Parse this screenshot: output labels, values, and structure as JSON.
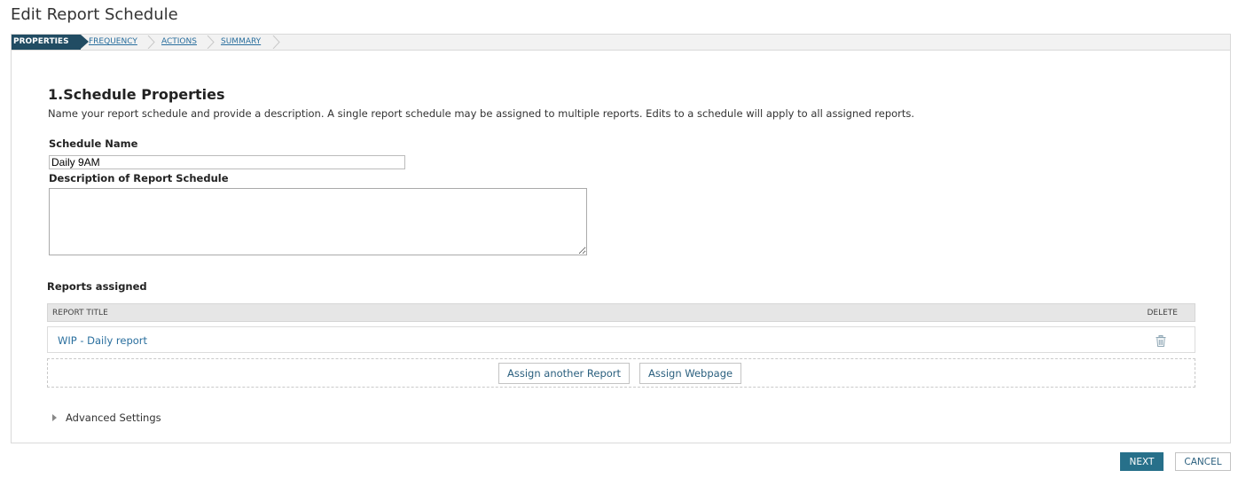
{
  "page": {
    "title": "Edit Report Schedule"
  },
  "steps": [
    {
      "label": "PROPERTIES",
      "active": true
    },
    {
      "label": "FREQUENCY",
      "active": false
    },
    {
      "label": "ACTIONS",
      "active": false
    },
    {
      "label": "SUMMARY",
      "active": false
    }
  ],
  "section": {
    "title": "1.Schedule Properties",
    "description": "Name your report schedule and provide a description. A single report schedule may be assigned to multiple reports. Edits to a schedule will apply to all assigned reports."
  },
  "form": {
    "name_label": "Schedule Name",
    "name_value": "Daily 9AM",
    "description_label": "Description of Report Schedule",
    "description_value": ""
  },
  "reports": {
    "label": "Reports assigned",
    "columns": {
      "title": "REPORT TITLE",
      "delete": "DELETE"
    },
    "rows": [
      {
        "title": "WIP - Daily report",
        "delete_icon": "trash-icon"
      }
    ],
    "assign_report_label": "Assign another Report",
    "assign_webpage_label": "Assign Webpage"
  },
  "advanced": {
    "label": "Advanced Settings",
    "icon": "caret-right-icon"
  },
  "footer": {
    "next_label": "NEXT",
    "cancel_label": "CANCEL"
  },
  "colors": {
    "accent": "#214c63",
    "link": "#2a6f9e",
    "next_button": "#27708a"
  }
}
